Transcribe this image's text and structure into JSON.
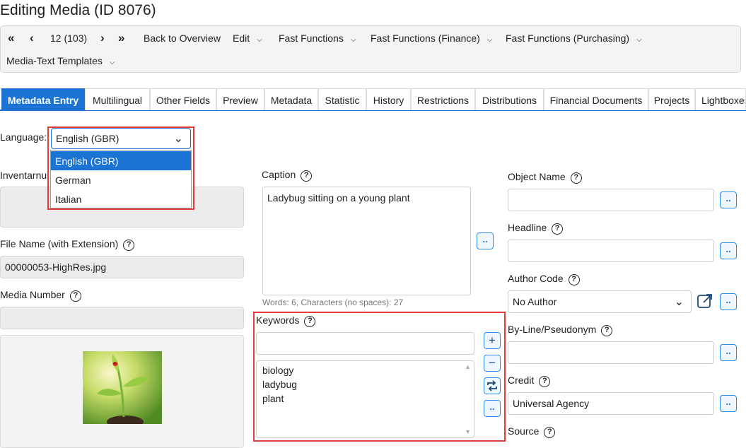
{
  "page": {
    "title": "Editing Media (ID 8076)"
  },
  "toolbar": {
    "first_icon": "«",
    "prev_icon": "‹",
    "position": "12 (103)",
    "next_icon": "›",
    "last_icon": "»",
    "back": "Back to Overview",
    "edit": "Edit",
    "fast_functions": "Fast Functions",
    "fast_functions_finance": "Fast Functions (Finance)",
    "fast_functions_purchasing": "Fast Functions (Purchasing)",
    "media_text_templates": "Media-Text Templates"
  },
  "tabs": [
    {
      "label": "Metadata Entry"
    },
    {
      "label": "Multilingual"
    },
    {
      "label": "Other Fields"
    },
    {
      "label": "Preview"
    },
    {
      "label": "Metadata"
    },
    {
      "label": "Statistic"
    },
    {
      "label": "History"
    },
    {
      "label": "Restrictions"
    },
    {
      "label": "Distributions"
    },
    {
      "label": "Financial Documents"
    },
    {
      "label": "Projects"
    },
    {
      "label": "Lightboxes"
    }
  ],
  "language": {
    "label": "Language:",
    "selected": "English (GBR)",
    "options": [
      "English (GBR)",
      "German",
      "Italian"
    ]
  },
  "left": {
    "inventory_label": "Inventarnu",
    "file_name_label": "File Name (with Extension)",
    "file_name_value": "00000053-HighRes.jpg",
    "media_number_label": "Media Number"
  },
  "caption": {
    "label": "Caption",
    "value": "Ladybug sitting on a young plant",
    "word_count": "Words: 6, Characters (no spaces): 27",
    "dots": ".."
  },
  "keywords": {
    "label": "Keywords",
    "input_value": "",
    "items": [
      "biology",
      "ladybug",
      "plant"
    ],
    "add": "+",
    "remove": "−",
    "dots": ".."
  },
  "right": {
    "object_name_label": "Object Name",
    "headline_label": "Headline",
    "author_code_label": "Author Code",
    "author_code_value": "No Author",
    "byline_label": "By-Line/Pseudonym",
    "credit_label": "Credit",
    "credit_value": "Universal Agency",
    "source_label": "Source",
    "dots": ".."
  },
  "help_glyph": "?",
  "colors": {
    "accent": "#1b73d3",
    "highlight": "#e53b3b"
  }
}
